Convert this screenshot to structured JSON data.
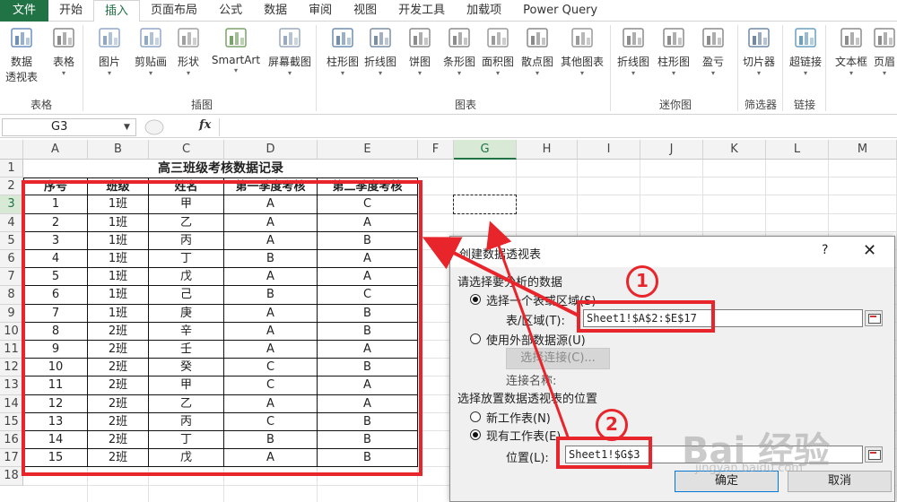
{
  "tabs": [
    "文件",
    "开始",
    "插入",
    "页面布局",
    "公式",
    "数据",
    "审阅",
    "视图",
    "开发工具",
    "加载项",
    "Power Query"
  ],
  "ribbon": {
    "buttons": [
      {
        "label": "数据",
        "sub": "透视表",
        "icon": "pivot-table-icon"
      },
      {
        "label": "表格",
        "icon": "table-icon"
      },
      {
        "label": "图片",
        "icon": "picture-icon"
      },
      {
        "label": "剪贴画",
        "icon": "clipart-icon"
      },
      {
        "label": "形状",
        "icon": "shapes-icon"
      },
      {
        "label": "SmartArt",
        "icon": "smartart-icon"
      },
      {
        "label": "屏幕截图",
        "icon": "screenshot-icon"
      },
      {
        "label": "柱形图",
        "icon": "column-chart-icon"
      },
      {
        "label": "折线图",
        "icon": "line-chart-icon"
      },
      {
        "label": "饼图",
        "icon": "pie-chart-icon"
      },
      {
        "label": "条形图",
        "icon": "bar-chart-icon"
      },
      {
        "label": "面积图",
        "icon": "area-chart-icon"
      },
      {
        "label": "散点图",
        "icon": "scatter-chart-icon"
      },
      {
        "label": "其他图表",
        "icon": "other-charts-icon"
      },
      {
        "label": "折线图",
        "icon": "sparkline-line-icon"
      },
      {
        "label": "柱形图",
        "icon": "sparkline-column-icon"
      },
      {
        "label": "盈亏",
        "icon": "sparkline-winloss-icon"
      },
      {
        "label": "切片器",
        "icon": "slicer-icon"
      },
      {
        "label": "超链接",
        "icon": "hyperlink-icon"
      },
      {
        "label": "文本框",
        "icon": "textbox-icon"
      },
      {
        "label": "页眉",
        "icon": "header-icon"
      }
    ],
    "groups": [
      "表格",
      "插图",
      "图表",
      "迷你图",
      "筛选器",
      "链接"
    ]
  },
  "formula_bar": {
    "name_box": "G3",
    "fx": "fx"
  },
  "columns": [
    "A",
    "B",
    "C",
    "D",
    "E",
    "F",
    "G",
    "H",
    "I",
    "J",
    "K",
    "L",
    "M"
  ],
  "rows": [
    "1",
    "2",
    "3",
    "4",
    "5",
    "6",
    "7",
    "8",
    "9",
    "10",
    "11",
    "12",
    "13",
    "14",
    "15",
    "16",
    "17",
    "18"
  ],
  "sheet": {
    "title": "高三班级考核数据记录",
    "headers": [
      "序号",
      "班级",
      "姓名",
      "第一季度考核",
      "第二季度考核"
    ],
    "data": [
      [
        "1",
        "1班",
        "甲",
        "A",
        "C"
      ],
      [
        "2",
        "1班",
        "乙",
        "A",
        "A"
      ],
      [
        "3",
        "1班",
        "丙",
        "A",
        "B"
      ],
      [
        "4",
        "1班",
        "丁",
        "B",
        "A"
      ],
      [
        "5",
        "1班",
        "戊",
        "A",
        "A"
      ],
      [
        "6",
        "1班",
        "己",
        "B",
        "C"
      ],
      [
        "7",
        "1班",
        "庚",
        "A",
        "B"
      ],
      [
        "8",
        "2班",
        "辛",
        "A",
        "B"
      ],
      [
        "9",
        "2班",
        "壬",
        "A",
        "A"
      ],
      [
        "10",
        "2班",
        "癸",
        "C",
        "B"
      ],
      [
        "11",
        "2班",
        "甲",
        "C",
        "A"
      ],
      [
        "12",
        "2班",
        "乙",
        "A",
        "A"
      ],
      [
        "13",
        "2班",
        "丙",
        "C",
        "B"
      ],
      [
        "14",
        "2班",
        "丁",
        "B",
        "B"
      ],
      [
        "15",
        "2班",
        "戊",
        "A",
        "B"
      ]
    ]
  },
  "dialog": {
    "title": "创建数据透视表",
    "help": "?",
    "close": "✕",
    "section1": "请选择要分析的数据",
    "opt_select_table": "选择一个表或区域(S)",
    "table_range_label": "表/区域(T):",
    "table_range_value": "Sheet1!$A$2:$E$17",
    "opt_external": "使用外部数据源(U)",
    "choose_conn": "选择连接(C)...",
    "conn_name_label": "连接名称:",
    "section2": "选择放置数据透视表的位置",
    "opt_new_sheet": "新工作表(N)",
    "opt_existing_sheet": "现有工作表(E)",
    "location_label": "位置(L):",
    "location_value": "Sheet1!$G$3",
    "ok": "确定",
    "cancel": "取消"
  },
  "annotations": {
    "circle1": "1",
    "circle2": "2"
  },
  "watermark": {
    "main": "Bai 经验",
    "url": "jingyan.baidu.com"
  },
  "colors": {
    "excel_green": "#217346",
    "annotation_red": "#e8252b"
  }
}
